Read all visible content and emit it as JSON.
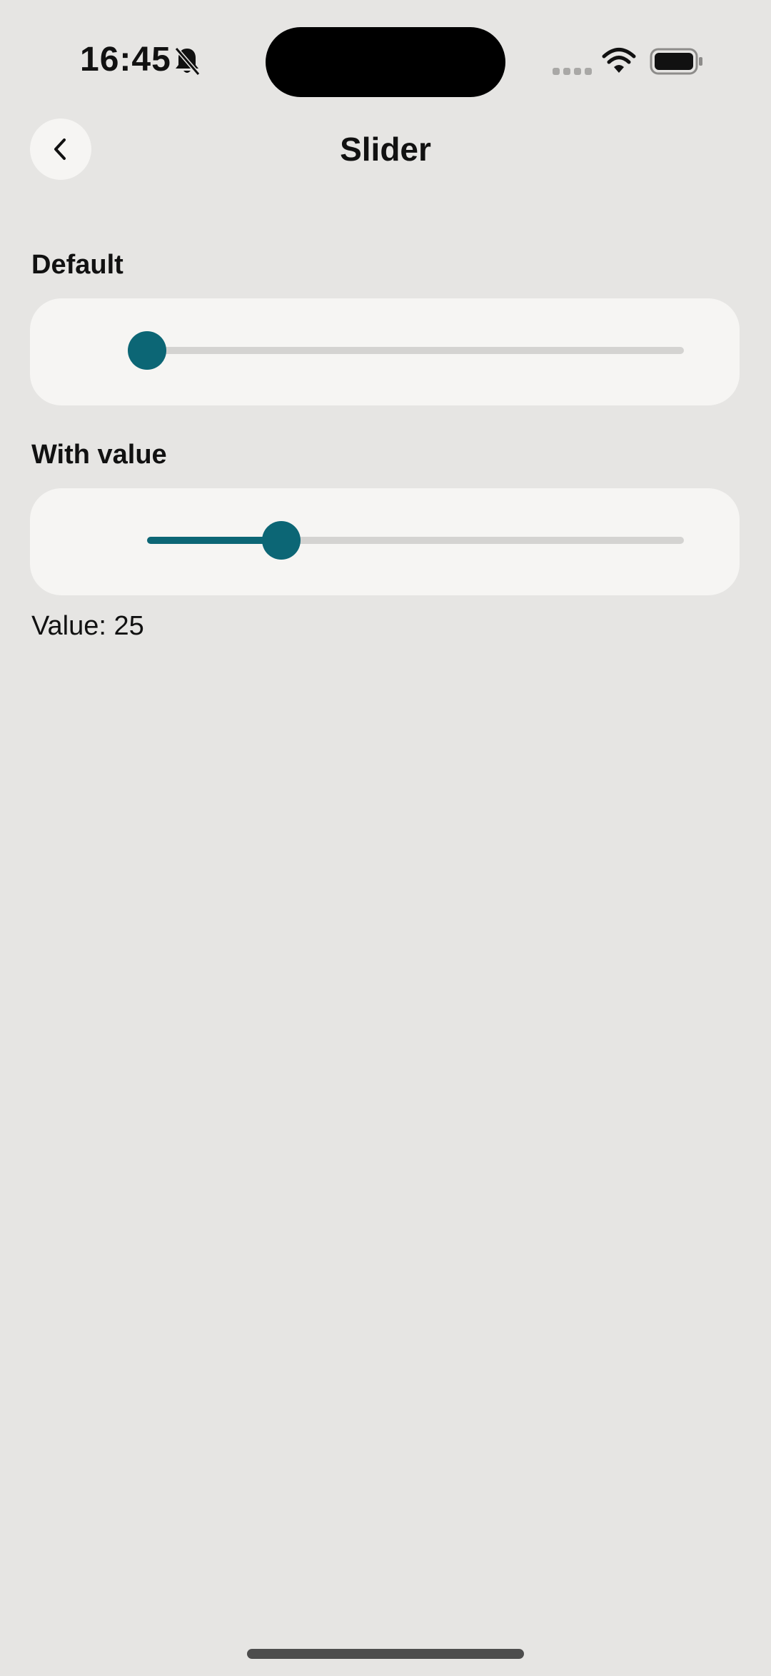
{
  "status_bar": {
    "time": "16:45",
    "mute_icon": "bell-slash-icon",
    "signal_icon": "cellular-signal-icon",
    "wifi_icon": "wifi-icon",
    "battery_icon": "battery-icon"
  },
  "header": {
    "back_icon": "chevron-left-icon",
    "title": "Slider"
  },
  "sections": {
    "default": {
      "label": "Default",
      "value_fraction": 0.0
    },
    "with_value": {
      "label": "With value",
      "value_fraction": 0.25,
      "value_text": "Value: 25"
    }
  },
  "colors": {
    "background": "#e6e5e3",
    "card": "#f6f5f3",
    "accent": "#0c6675",
    "track": "#d4d3d1"
  }
}
